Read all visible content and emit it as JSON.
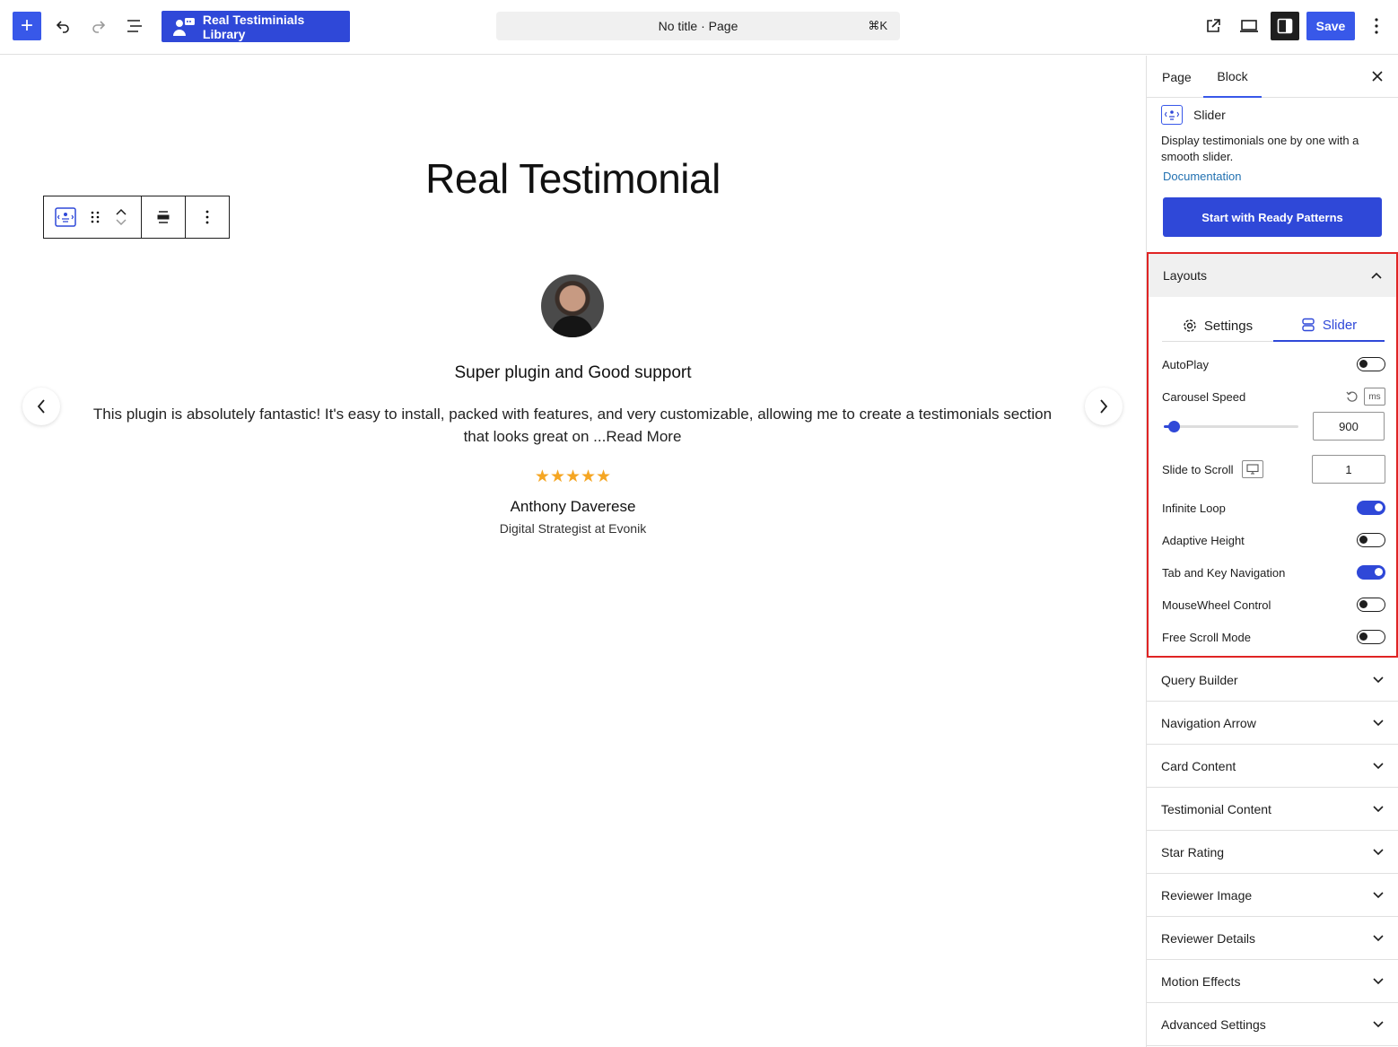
{
  "topbar": {
    "add_icon": "plus-icon",
    "library_button": "Real Testiminials Library",
    "command_bar": "No title · Page",
    "command_shortcut": "⌘K",
    "save": "Save"
  },
  "canvas": {
    "page_title": "Real Testimonial",
    "testimonial": {
      "title": "Super plugin and Good support",
      "body": "This plugin is absolutely fantastic! It's easy to install, packed with features, and very customizable, allowing me to create a testimonials section that looks great on ...Read More",
      "rating": 5,
      "stars": "★★★★★",
      "reviewer": "Anthony Daverese",
      "designation": "Digital Strategist at Evonik"
    }
  },
  "sidebar": {
    "tabs": [
      "Page",
      "Block"
    ],
    "active_tab": "Block",
    "block": {
      "name": "Slider",
      "description": "Display testimonials one by one with a smooth slider.",
      "doc_link": "Documentation",
      "patterns_button": "Start with Ready Patterns"
    },
    "layouts": {
      "title": "Layouts",
      "tabs": [
        "Settings",
        "Slider"
      ],
      "active_tab": "Slider",
      "autoplay": {
        "label": "AutoPlay",
        "on": false
      },
      "carousel_speed": {
        "label": "Carousel Speed",
        "unit": "ms",
        "value": "900",
        "slider_fraction": 0.06
      },
      "slide_to_scroll": {
        "label": "Slide to Scroll",
        "value": "1"
      },
      "infinite_loop": {
        "label": "Infinite Loop",
        "on": true
      },
      "adaptive_height": {
        "label": "Adaptive Height",
        "on": false
      },
      "tab_key_nav": {
        "label": "Tab and Key Navigation",
        "on": true
      },
      "mousewheel": {
        "label": "MouseWheel Control",
        "on": false
      },
      "free_scroll": {
        "label": "Free Scroll Mode",
        "on": false
      }
    },
    "accordions": [
      "Query Builder",
      "Navigation Arrow",
      "Card Content",
      "Testimonial Content",
      "Star Rating",
      "Reviewer Image",
      "Reviewer Details",
      "Motion Effects",
      "Advanced Settings"
    ]
  },
  "colors": {
    "accent": "#3858e9",
    "highlight_border": "#e02424",
    "star": "#f5a623"
  }
}
